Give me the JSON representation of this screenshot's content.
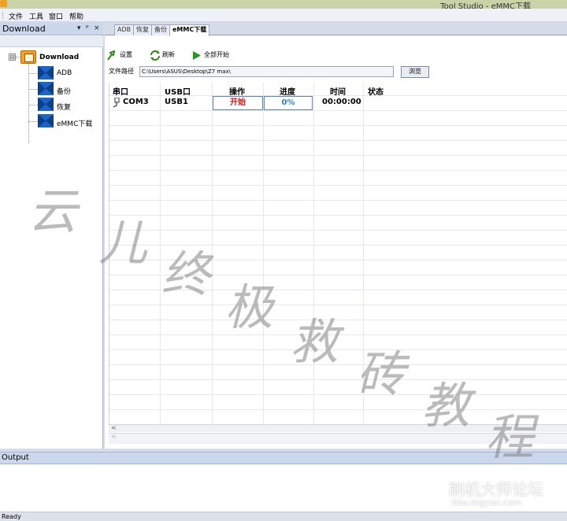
{
  "window": {
    "title": "Tool Studio - eMMC下载"
  },
  "menu": {
    "items": [
      "文件",
      "工具",
      "窗口",
      "帮助"
    ]
  },
  "left_panel": {
    "title": "Download",
    "buttons": [
      "▾",
      "ᵖ",
      "×"
    ],
    "tree": {
      "expander": "⊟",
      "root": "Download",
      "children": [
        "ADB",
        "备份",
        "恢复",
        "eMMC下载"
      ]
    }
  },
  "tabs": [
    "ADB",
    "恢复",
    "备份",
    "eMMC下载"
  ],
  "active_tab": "eMMC下载",
  "toolbar": {
    "settings": "设置",
    "refresh": "刷新",
    "start_all": "全部开始"
  },
  "file_path": {
    "label": "文件路径",
    "value": "C:\\Users\\ASUS\\Desktop\\Z7 max\\",
    "browse": "浏览"
  },
  "table": {
    "headers": [
      "串口",
      "USB口",
      "操作",
      "进度",
      "时间",
      "状态"
    ],
    "rows": [
      {
        "port": "COM3",
        "usb": "USB1",
        "action": "开始",
        "progress": "0%",
        "time": "00:00:00",
        "status": ""
      }
    ]
  },
  "scroll": {
    "left_arrow": "<",
    "bottom_arrow": "<"
  },
  "output_panel": {
    "title": "Output"
  },
  "statusbar": {
    "text": "Ready"
  },
  "watermark": {
    "chars": [
      "云",
      "儿",
      "终",
      "极",
      "救",
      "砖",
      "教",
      "程"
    ],
    "forum": "刷机大师论坛",
    "url": "bbs.mgyun.com"
  }
}
